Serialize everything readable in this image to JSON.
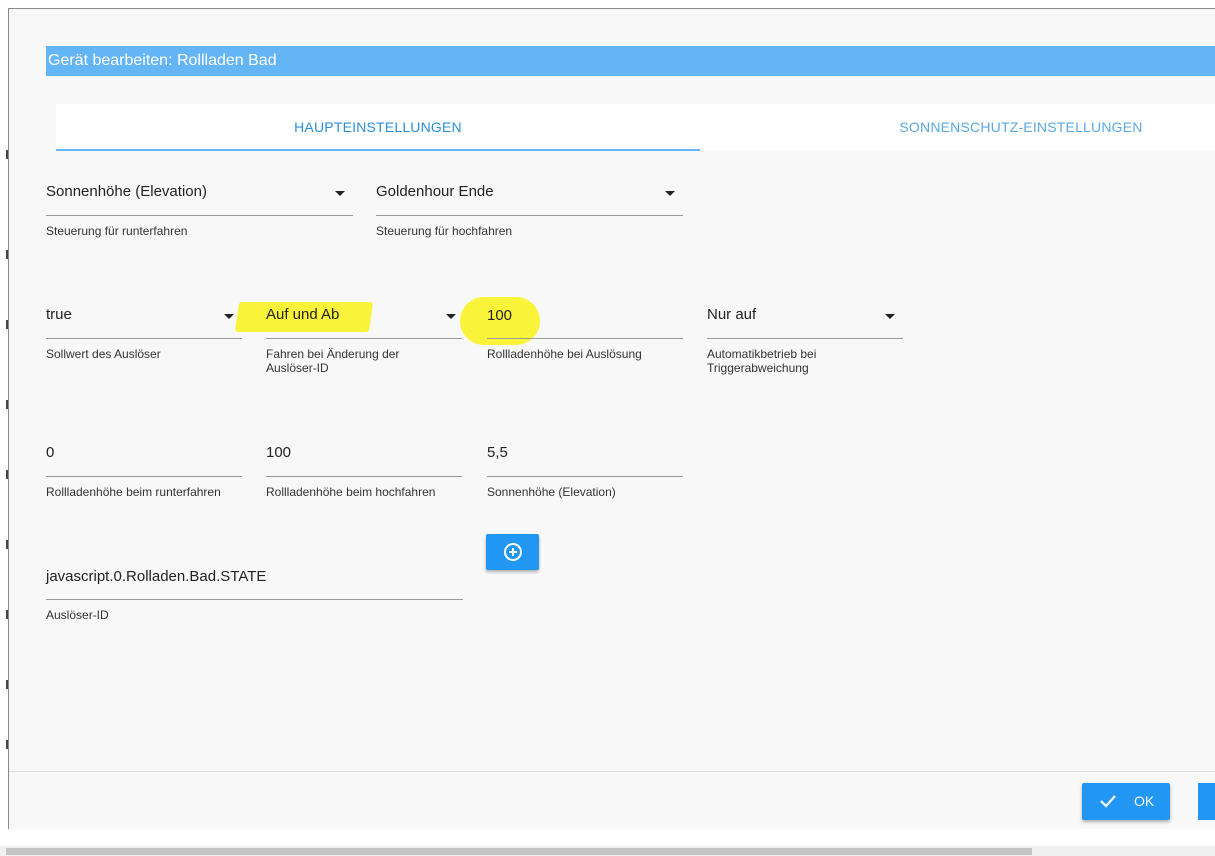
{
  "dialog": {
    "title": "Gerät bearbeiten: Rollladen Bad"
  },
  "tabs": [
    {
      "label": "HAUPTEINSTELLUNGEN",
      "active": true
    },
    {
      "label": "SONNENSCHUTZ-EINSTELLUNGEN",
      "active": false
    }
  ],
  "fields": {
    "down_control": {
      "value": "Sonnenhöhe (Elevation)",
      "help": "Steuerung für runterfahren"
    },
    "up_control": {
      "value": "Goldenhour Ende",
      "help": "Steuerung für hochfahren"
    },
    "trigger_value": {
      "value": "true",
      "help": "Sollwert des Auslöser"
    },
    "trigger_change": {
      "value": "Auf und Ab",
      "help_line1": "Fahren bei Änderung der",
      "help_line2": "Auslöser-ID"
    },
    "trigger_height": {
      "value": "100",
      "help": "Rollladenhöhe bei Auslösung"
    },
    "auto_mode": {
      "value": "Nur auf",
      "help_line1": "Automatikbetrieb bei",
      "help_line2": "Triggerabweichung"
    },
    "height_down": {
      "value": "0",
      "help": "Rollladenhöhe beim runterfahren"
    },
    "height_up": {
      "value": "100",
      "help": "Rollladenhöhe beim hochfahren"
    },
    "elevation": {
      "value": "5,5",
      "help": "Sonnenhöhe (Elevation)"
    },
    "trigger_id": {
      "value": "javascript.0.Rolladen.Bad.STATE",
      "help": "Auslöser-ID"
    }
  },
  "buttons": {
    "ok_label": "OK"
  },
  "colors": {
    "accent": "#2196f3",
    "title_bar": "#64b5f6",
    "highlight": "#f9f33a"
  }
}
